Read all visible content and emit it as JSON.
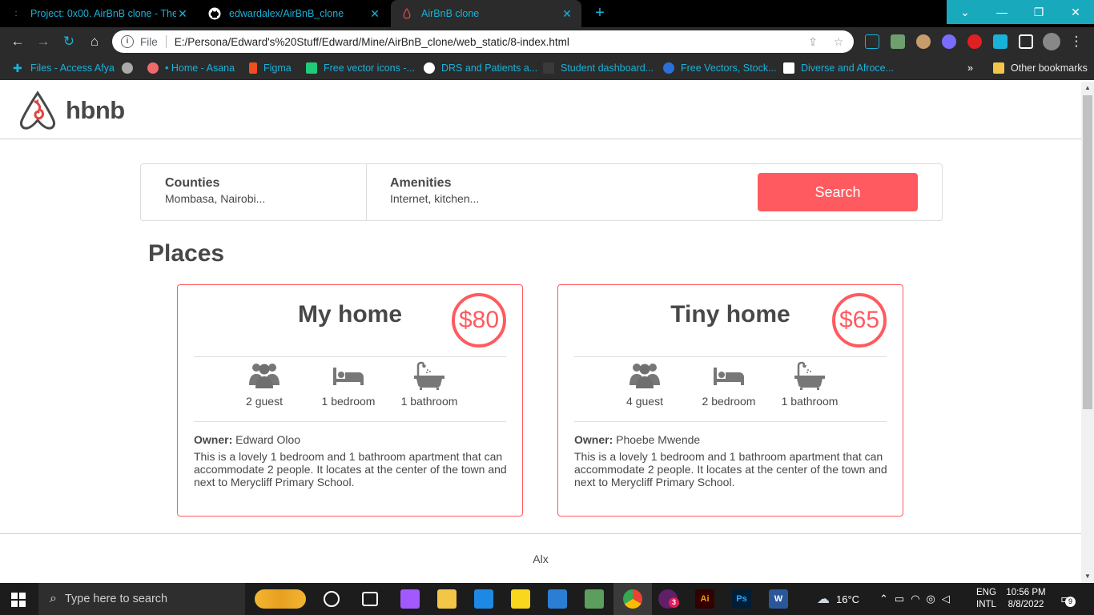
{
  "browser": {
    "tabs": [
      {
        "title": "Project: 0x00. AirBnB clone - The",
        "icon": "alx-icon"
      },
      {
        "title": "edwardalex/AirBnB_clone",
        "icon": "github-icon"
      },
      {
        "title": "AirBnB clone",
        "icon": "page-icon"
      }
    ],
    "new_tab": "+",
    "close": "✕",
    "url_scheme": "File",
    "url": "E:/Persona/Edward's%20Stuff/Edward/Mine/AirBnB_clone/web_static/8-index.html",
    "bookmarks": [
      "Files - Access Afya",
      "• Home - Asana",
      "Figma",
      "Free vector icons -...",
      "DRS and Patients a...",
      "Student dashboard...",
      "Free Vectors, Stock...",
      "Diverse and Afroce..."
    ],
    "more_bookmarks": "»",
    "other_bookmarks": "Other bookmarks",
    "accent_color": "#1ab1d8"
  },
  "site": {
    "logo_text": "hbnb",
    "filters": {
      "counties_title": "Counties",
      "counties_value": "Mombasa, Nairobi...",
      "amenities_title": "Amenities",
      "amenities_value": "Internet, kitchen..."
    },
    "search_label": "Search",
    "places_title": "Places",
    "brand_color": "#ff5a5f",
    "text_color": "#484848",
    "places": [
      {
        "title": "My home",
        "price": "$80",
        "guests": "2 guest",
        "bedrooms": "1 bedroom",
        "bathrooms": "1 bathroom",
        "owner_label": "Owner:",
        "owner": "Edward Oloo",
        "description": "This is a lovely 1 bedroom and 1 bathroom apartment that can accommodate 2 people. It locates at the center of the town and next to Merycliff Primary School."
      },
      {
        "title": "Tiny home",
        "price": "$65",
        "guests": "4 guest",
        "bedrooms": "2 bedroom",
        "bathrooms": "1 bathroom",
        "owner_label": "Owner:",
        "owner": "Phoebe Mwende",
        "description": "This is a lovely 1 bedroom and 1 bathroom apartment that can accommodate 2 people. It locates at the center of the town and next to Merycliff Primary School."
      }
    ],
    "footer": "Alx"
  },
  "taskbar": {
    "search_placeholder": "Type here to search",
    "weather": "16°C",
    "lang_top": "ENG",
    "lang_bottom": "INTL",
    "time": "10:56 PM",
    "date": "8/8/2022",
    "notifications": "9",
    "slack_badge": "3"
  }
}
